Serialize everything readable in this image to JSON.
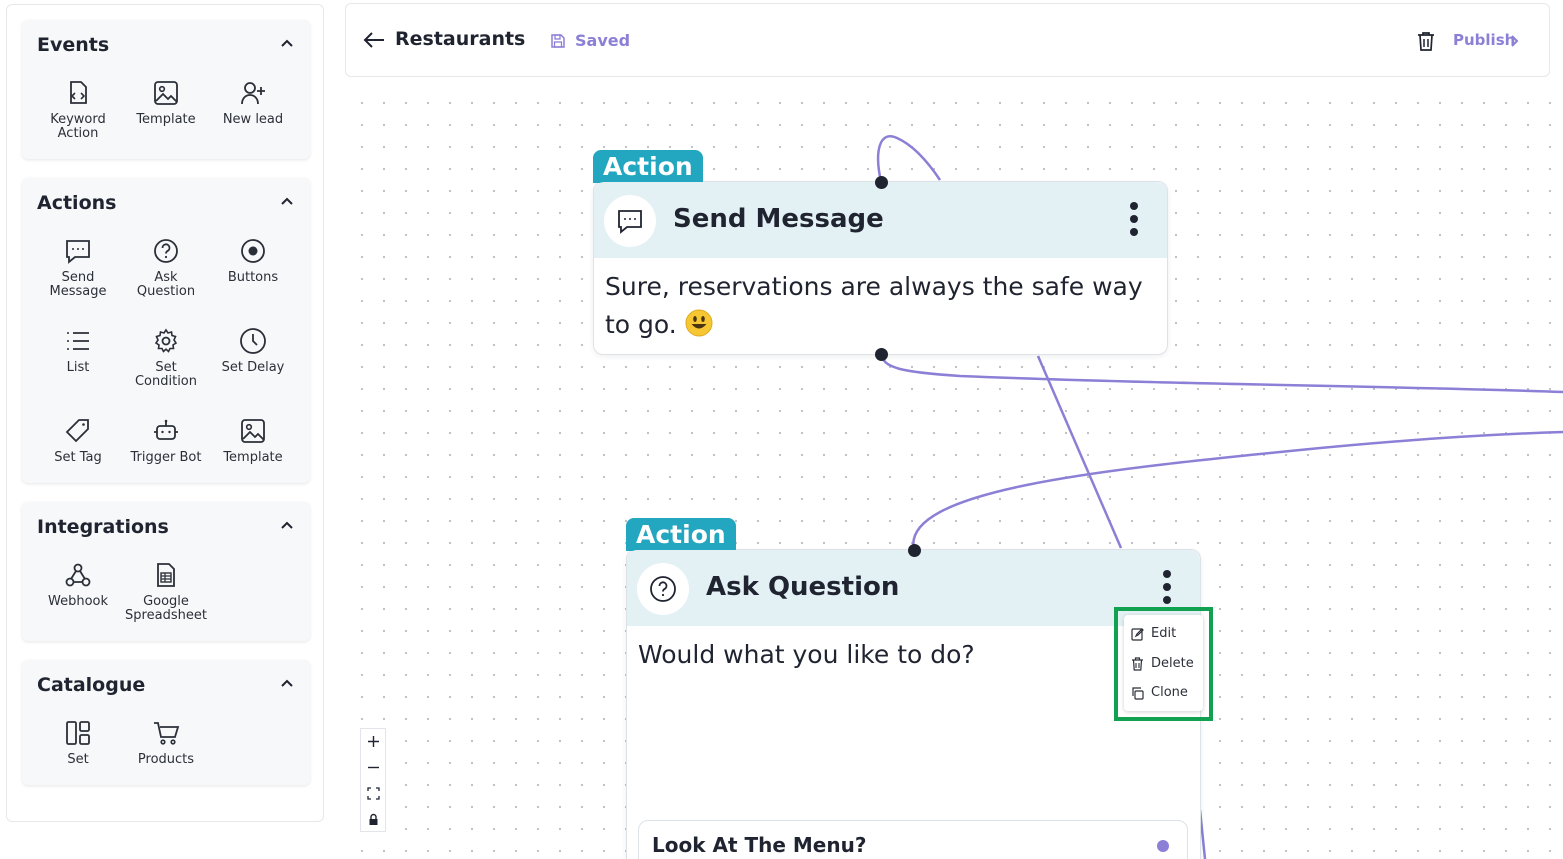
{
  "sidebar": {
    "events": {
      "title": "Events",
      "items": [
        {
          "label_line1": "Keyword",
          "label_line2": "Action",
          "icon": "keyword-action-icon"
        },
        {
          "label_line1": "Template",
          "label_line2": "",
          "icon": "image-icon"
        },
        {
          "label_line1": "New lead",
          "label_line2": "",
          "icon": "user-plus-icon"
        }
      ]
    },
    "actions": {
      "title": "Actions",
      "items": [
        {
          "label_line1": "Send",
          "label_line2": "Message",
          "icon": "message-icon"
        },
        {
          "label_line1": "Ask",
          "label_line2": "Question",
          "icon": "question-icon"
        },
        {
          "label_line1": "Buttons",
          "label_line2": "",
          "icon": "radio-button-icon"
        },
        {
          "label_line1": "List",
          "label_line2": "",
          "icon": "list-icon"
        },
        {
          "label_line1": "Set",
          "label_line2": "Condition",
          "icon": "gear-icon"
        },
        {
          "label_line1": "Set Delay",
          "label_line2": "",
          "icon": "clock-icon"
        },
        {
          "label_line1": "Set Tag",
          "label_line2": "",
          "icon": "tag-icon"
        },
        {
          "label_line1": "Trigger Bot",
          "label_line2": "",
          "icon": "bot-icon"
        },
        {
          "label_line1": "Template",
          "label_line2": "",
          "icon": "image-icon"
        }
      ]
    },
    "integrations": {
      "title": "Integrations",
      "items": [
        {
          "label_line1": "Webhook",
          "label_line2": "",
          "icon": "webhook-icon"
        },
        {
          "label_line1": "Google",
          "label_line2": "Spreadsheet",
          "icon": "spreadsheet-icon"
        }
      ]
    },
    "catalogue": {
      "title": "Catalogue",
      "items": [
        {
          "label_line1": "Set",
          "label_line2": "",
          "icon": "layout-icon"
        },
        {
          "label_line1": "Products",
          "label_line2": "",
          "icon": "cart-icon"
        }
      ]
    }
  },
  "header": {
    "title": "Restaurants",
    "status": "Saved",
    "publish_label": "Publish"
  },
  "nodes": {
    "send_message": {
      "tag": "Action",
      "title": "Send Message",
      "body": "Sure, reservations are always the safe way to go."
    },
    "ask_question": {
      "tag": "Action",
      "title": "Ask Question",
      "body": "Would what you like to do?",
      "option": "Look At The Menu?"
    }
  },
  "context_menu": {
    "items": [
      "Edit",
      "Delete",
      "Clone"
    ]
  },
  "colors": {
    "accent": "#8b7fd6",
    "tag": "#23a6bf",
    "node_header": "#e3f1f5",
    "highlight": "#12a151",
    "edge": "#8b7fd6"
  }
}
